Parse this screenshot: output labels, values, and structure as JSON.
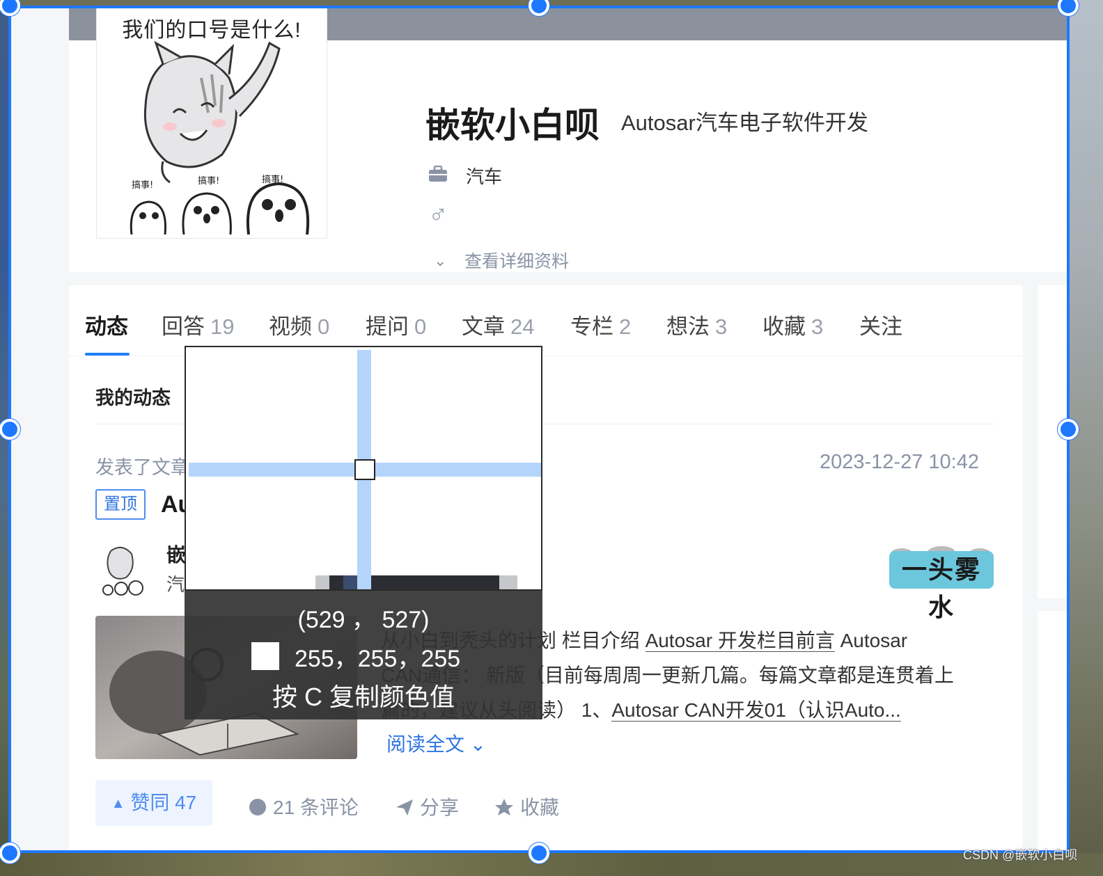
{
  "profile": {
    "avatar_caption": "我们的口号是什么!",
    "avatar_labels": [
      "搞事!",
      "搞事!",
      "搞事!"
    ],
    "name": "嵌软小白呗",
    "bio": "Autosar汽车电子软件开发",
    "industry": "汽车",
    "gender_symbol": "♂",
    "view_details": "查看详细资料"
  },
  "tabs": [
    {
      "label": "动态",
      "count": ""
    },
    {
      "label": "回答",
      "count": "19"
    },
    {
      "label": "视频",
      "count": "0"
    },
    {
      "label": "提问",
      "count": "0"
    },
    {
      "label": "文章",
      "count": "24"
    },
    {
      "label": "专栏",
      "count": "2"
    },
    {
      "label": "想法",
      "count": "3"
    },
    {
      "label": "收藏",
      "count": "3"
    },
    {
      "label": "关注",
      "count": ""
    }
  ],
  "feed": {
    "section_title": "我的动态",
    "activity_type": "发表了文章",
    "timestamp": "2023-12-27 10:42",
    "pin_label": "置顶",
    "post_title": "Au",
    "author_name": "嵌",
    "author_meta": "汽",
    "column_logo_text": "一头雾水",
    "excerpt_line1_a": "从小白到秃头的计划 栏目介绍 ",
    "excerpt_line1_link": "Autosar 开发栏目前言",
    "excerpt_line1_b": " Autosar",
    "excerpt_line2": "CAN通信：  新版（目前每周周一更新几篇。每篇文章都是连贯着上",
    "excerpt_line3_a": "篇的，建议从头阅读）  1、",
    "excerpt_line3_link": "Autosar CAN开发01（认识Auto...",
    "read_more": "阅读全文",
    "like_label": "赞同 47",
    "comments_label": "21 条评论",
    "share_label": "分享",
    "favorite_label": "收藏"
  },
  "color_picker": {
    "coords": "(529 ， 527)",
    "rgb": "255，255，255",
    "swatch_color": "#ffffff",
    "hint": "按 C 复制颜色值"
  },
  "watermark": "CSDN @嵌软小白呗"
}
